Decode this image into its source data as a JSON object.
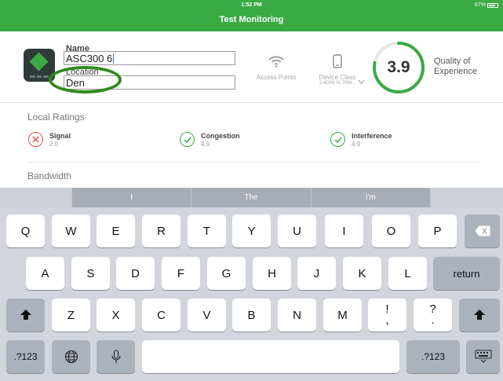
{
  "status_bar": {
    "time": "1:52 PM",
    "battery": "67%"
  },
  "header": {
    "title": "Test Monitoring"
  },
  "device": {
    "name_label": "Name",
    "name_value": "ASC300 6",
    "location_label": "Location",
    "location_value": "Den"
  },
  "stats": {
    "access_points_label": "Access Points",
    "device_class_label": "Device Class",
    "device_class_value": "2.4GHz N, 20M..."
  },
  "qoe": {
    "value": "3.9",
    "fraction": 0.78,
    "label_line1": "Quality of",
    "label_line2": "Experience",
    "ring_color": "#3aaa45"
  },
  "local_ratings": {
    "title": "Local Ratings",
    "items": [
      {
        "name": "Signal",
        "value": "2.0",
        "status": "bad",
        "color": "#e84c4c"
      },
      {
        "name": "Congestion",
        "value": "4.9",
        "status": "good",
        "color": "#3aaa45"
      },
      {
        "name": "Interference",
        "value": "4.9",
        "status": "good",
        "color": "#3aaa45"
      }
    ]
  },
  "bandwidth": {
    "title": "Bandwidth"
  },
  "keyboard": {
    "suggestions": [
      "I",
      "The",
      "I'm"
    ],
    "row1": [
      "Q",
      "W",
      "E",
      "R",
      "T",
      "Y",
      "U",
      "I",
      "O",
      "P"
    ],
    "row2": [
      "A",
      "S",
      "D",
      "F",
      "G",
      "H",
      "J",
      "K",
      "L"
    ],
    "row3": [
      "Z",
      "X",
      "C",
      "V",
      "B",
      "N",
      "M"
    ],
    "return_label": "return",
    "numbers_label": ".?123",
    "punct1_top": "!",
    "punct1_bottom": ",",
    "punct2_top": "?",
    "punct2_bottom": "."
  }
}
